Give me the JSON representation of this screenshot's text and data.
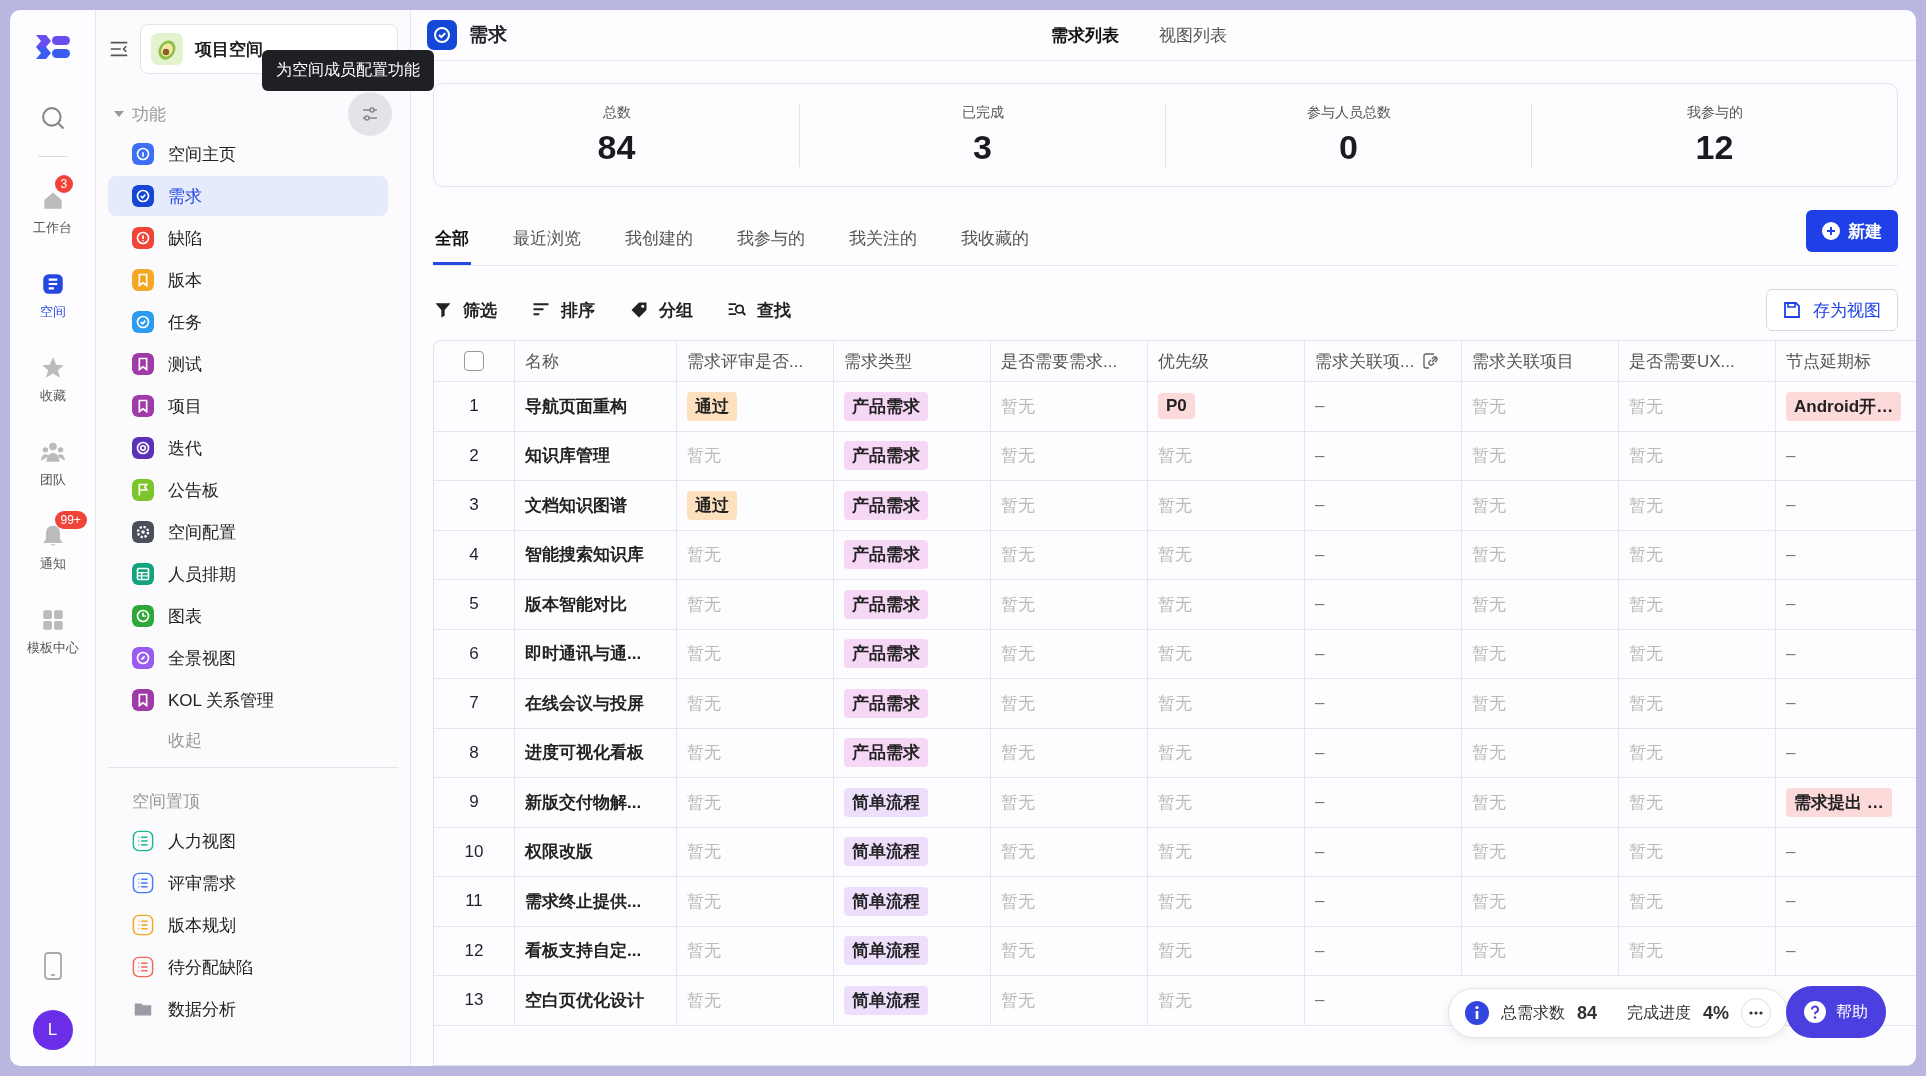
{
  "tooltip": "为空间成员配置功能",
  "rail": {
    "avatar": "L",
    "items": [
      {
        "label": "工作台",
        "badge": "3",
        "selected": false
      },
      {
        "label": "空间",
        "selected": true
      },
      {
        "label": "收藏",
        "selected": false
      },
      {
        "label": "团队",
        "selected": false
      },
      {
        "label": "通知",
        "badge": "99+",
        "selected": false
      },
      {
        "label": "模板中心",
        "selected": false
      }
    ]
  },
  "sidebar": {
    "space": "项目空间",
    "section": "功能",
    "collapse": "收起",
    "pinned_title": "空间置顶",
    "items": [
      {
        "label": "空间主页",
        "color": "#3d6ff5",
        "selected": false
      },
      {
        "label": "需求",
        "color": "#1447d6",
        "selected": true
      },
      {
        "label": "缺陷",
        "color": "#f04438",
        "selected": false
      },
      {
        "label": "版本",
        "color": "#f5a623",
        "selected": false
      },
      {
        "label": "任务",
        "color": "#2c9cf0",
        "selected": false
      },
      {
        "label": "测试",
        "color": "#a03aa8",
        "selected": false
      },
      {
        "label": "项目",
        "color": "#a03aa8",
        "selected": false
      },
      {
        "label": "迭代",
        "color": "#5a32b8",
        "selected": false
      },
      {
        "label": "公告板",
        "color": "#7cc52a",
        "selected": false
      },
      {
        "label": "空间配置",
        "color": "#4a4f5a",
        "selected": false
      },
      {
        "label": "人员排期",
        "color": "#14a37f",
        "selected": false
      },
      {
        "label": "图表",
        "color": "#2fa83a",
        "selected": false
      },
      {
        "label": "全景视图",
        "color": "#9a5cf0",
        "selected": false
      },
      {
        "label": "KOL 关系管理",
        "color": "#a03aa8",
        "selected": false
      }
    ],
    "pinned": [
      {
        "label": "人力视图",
        "kind": "view",
        "color": "#1fb59a"
      },
      {
        "label": "评审需求",
        "kind": "view",
        "color": "#4a7af5"
      },
      {
        "label": "版本规划",
        "kind": "view",
        "color": "#f5a623"
      },
      {
        "label": "待分配缺陷",
        "kind": "view",
        "color": "#f06a5a"
      },
      {
        "label": "数据分析",
        "kind": "folder",
        "color": "#9a9ca3"
      }
    ]
  },
  "header": {
    "title": "需求",
    "tabs": [
      {
        "label": "需求列表",
        "selected": true
      },
      {
        "label": "视图列表",
        "selected": false
      }
    ]
  },
  "stats": [
    {
      "label": "总数",
      "value": "84"
    },
    {
      "label": "已完成",
      "value": "3"
    },
    {
      "label": "参与人员总数",
      "value": "0"
    },
    {
      "label": "我参与的",
      "value": "12"
    }
  ],
  "filters": [
    {
      "label": "全部",
      "selected": true
    },
    {
      "label": "最近浏览",
      "selected": false
    },
    {
      "label": "我创建的",
      "selected": false
    },
    {
      "label": "我参与的",
      "selected": false
    },
    {
      "label": "我关注的",
      "selected": false
    },
    {
      "label": "我收藏的",
      "selected": false
    }
  ],
  "new_button": "新建",
  "toolbar": [
    "筛选",
    "排序",
    "分组",
    "查找"
  ],
  "save_view": "存为视图",
  "table": {
    "columns": [
      {
        "kind": "select",
        "checked": false
      },
      {
        "label": "名称",
        "kind": "plain"
      },
      {
        "label": "需求评审是否...",
        "kind": "plain"
      },
      {
        "label": "需求类型",
        "kind": "plain"
      },
      {
        "label": "是否需要需求...",
        "kind": "plain"
      },
      {
        "label": "优先级",
        "kind": "plain"
      },
      {
        "label": "需求关联项...",
        "kind": "linked"
      },
      {
        "label": "需求关联项目",
        "kind": "plain"
      },
      {
        "label": "是否需要UX...",
        "kind": "plain"
      },
      {
        "label": "节点延期标",
        "kind": "plain"
      }
    ],
    "rows": [
      {
        "cells": [
          {
            "text": "1",
            "kind": "number"
          },
          {
            "text": "导航页面重构",
            "kind": "name"
          },
          {
            "text": "通过",
            "kind": "tag",
            "color": "#fde0bd"
          },
          {
            "text": "产品需求",
            "kind": "tag",
            "color": "#f6d8f6"
          },
          {
            "text": "暂无",
            "kind": "empty"
          },
          {
            "text": "P0",
            "kind": "tag",
            "color": "#fddada"
          },
          {
            "text": "–",
            "kind": "dash"
          },
          {
            "text": "暂无",
            "kind": "empty"
          },
          {
            "text": "暂无",
            "kind": "empty"
          },
          {
            "text": "Android开…",
            "kind": "tag",
            "color": "#fddada"
          }
        ]
      },
      {
        "cells": [
          {
            "text": "2",
            "kind": "number"
          },
          {
            "text": "知识库管理",
            "kind": "name"
          },
          {
            "text": "暂无",
            "kind": "empty"
          },
          {
            "text": "产品需求",
            "kind": "tag",
            "color": "#f6d8f6"
          },
          {
            "text": "暂无",
            "kind": "empty"
          },
          {
            "text": "暂无",
            "kind": "empty"
          },
          {
            "text": "–",
            "kind": "dash"
          },
          {
            "text": "暂无",
            "kind": "empty"
          },
          {
            "text": "暂无",
            "kind": "empty"
          },
          {
            "text": "–",
            "kind": "dash"
          }
        ]
      },
      {
        "cells": [
          {
            "text": "3",
            "kind": "number"
          },
          {
            "text": "文档知识图谱",
            "kind": "name"
          },
          {
            "text": "通过",
            "kind": "tag",
            "color": "#fde0bd"
          },
          {
            "text": "产品需求",
            "kind": "tag",
            "color": "#f6d8f6"
          },
          {
            "text": "暂无",
            "kind": "empty"
          },
          {
            "text": "暂无",
            "kind": "empty"
          },
          {
            "text": "–",
            "kind": "dash"
          },
          {
            "text": "暂无",
            "kind": "empty"
          },
          {
            "text": "暂无",
            "kind": "empty"
          },
          {
            "text": "–",
            "kind": "dash"
          }
        ]
      },
      {
        "cells": [
          {
            "text": "4",
            "kind": "number"
          },
          {
            "text": "智能搜索知识库",
            "kind": "name"
          },
          {
            "text": "暂无",
            "kind": "empty"
          },
          {
            "text": "产品需求",
            "kind": "tag",
            "color": "#f6d8f6"
          },
          {
            "text": "暂无",
            "kind": "empty"
          },
          {
            "text": "暂无",
            "kind": "empty"
          },
          {
            "text": "–",
            "kind": "dash"
          },
          {
            "text": "暂无",
            "kind": "empty"
          },
          {
            "text": "暂无",
            "kind": "empty"
          },
          {
            "text": "–",
            "kind": "dash"
          }
        ]
      },
      {
        "cells": [
          {
            "text": "5",
            "kind": "number"
          },
          {
            "text": "版本智能对比",
            "kind": "name"
          },
          {
            "text": "暂无",
            "kind": "empty"
          },
          {
            "text": "产品需求",
            "kind": "tag",
            "color": "#f6d8f6"
          },
          {
            "text": "暂无",
            "kind": "empty"
          },
          {
            "text": "暂无",
            "kind": "empty"
          },
          {
            "text": "–",
            "kind": "dash"
          },
          {
            "text": "暂无",
            "kind": "empty"
          },
          {
            "text": "暂无",
            "kind": "empty"
          },
          {
            "text": "–",
            "kind": "dash"
          }
        ]
      },
      {
        "cells": [
          {
            "text": "6",
            "kind": "number"
          },
          {
            "text": "即时通讯与通...",
            "kind": "name"
          },
          {
            "text": "暂无",
            "kind": "empty"
          },
          {
            "text": "产品需求",
            "kind": "tag",
            "color": "#f6d8f6"
          },
          {
            "text": "暂无",
            "kind": "empty"
          },
          {
            "text": "暂无",
            "kind": "empty"
          },
          {
            "text": "–",
            "kind": "dash"
          },
          {
            "text": "暂无",
            "kind": "empty"
          },
          {
            "text": "暂无",
            "kind": "empty"
          },
          {
            "text": "–",
            "kind": "dash"
          }
        ]
      },
      {
        "cells": [
          {
            "text": "7",
            "kind": "number"
          },
          {
            "text": "在线会议与投屏",
            "kind": "name"
          },
          {
            "text": "暂无",
            "kind": "empty"
          },
          {
            "text": "产品需求",
            "kind": "tag",
            "color": "#f6d8f6"
          },
          {
            "text": "暂无",
            "kind": "empty"
          },
          {
            "text": "暂无",
            "kind": "empty"
          },
          {
            "text": "–",
            "kind": "dash"
          },
          {
            "text": "暂无",
            "kind": "empty"
          },
          {
            "text": "暂无",
            "kind": "empty"
          },
          {
            "text": "–",
            "kind": "dash"
          }
        ]
      },
      {
        "cells": [
          {
            "text": "8",
            "kind": "number"
          },
          {
            "text": "进度可视化看板",
            "kind": "name"
          },
          {
            "text": "暂无",
            "kind": "empty"
          },
          {
            "text": "产品需求",
            "kind": "tag",
            "color": "#f6d8f6"
          },
          {
            "text": "暂无",
            "kind": "empty"
          },
          {
            "text": "暂无",
            "kind": "empty"
          },
          {
            "text": "–",
            "kind": "dash"
          },
          {
            "text": "暂无",
            "kind": "empty"
          },
          {
            "text": "暂无",
            "kind": "empty"
          },
          {
            "text": "–",
            "kind": "dash"
          }
        ]
      },
      {
        "cells": [
          {
            "text": "9",
            "kind": "number"
          },
          {
            "text": "新版交付物解...",
            "kind": "name"
          },
          {
            "text": "暂无",
            "kind": "empty"
          },
          {
            "text": "简单流程",
            "kind": "tag",
            "color": "#eddffb"
          },
          {
            "text": "暂无",
            "kind": "empty"
          },
          {
            "text": "暂无",
            "kind": "empty"
          },
          {
            "text": "–",
            "kind": "dash"
          },
          {
            "text": "暂无",
            "kind": "empty"
          },
          {
            "text": "暂无",
            "kind": "empty"
          },
          {
            "text": "需求提出 …",
            "kind": "tag",
            "color": "#fddada"
          }
        ]
      },
      {
        "cells": [
          {
            "text": "10",
            "kind": "number"
          },
          {
            "text": "权限改版",
            "kind": "name"
          },
          {
            "text": "暂无",
            "kind": "empty"
          },
          {
            "text": "简单流程",
            "kind": "tag",
            "color": "#eddffb"
          },
          {
            "text": "暂无",
            "kind": "empty"
          },
          {
            "text": "暂无",
            "kind": "empty"
          },
          {
            "text": "–",
            "kind": "dash"
          },
          {
            "text": "暂无",
            "kind": "empty"
          },
          {
            "text": "暂无",
            "kind": "empty"
          },
          {
            "text": "–",
            "kind": "dash"
          }
        ]
      },
      {
        "cells": [
          {
            "text": "11",
            "kind": "number"
          },
          {
            "text": "需求终止提供...",
            "kind": "name"
          },
          {
            "text": "暂无",
            "kind": "empty"
          },
          {
            "text": "简单流程",
            "kind": "tag",
            "color": "#eddffb"
          },
          {
            "text": "暂无",
            "kind": "empty"
          },
          {
            "text": "暂无",
            "kind": "empty"
          },
          {
            "text": "–",
            "kind": "dash"
          },
          {
            "text": "暂无",
            "kind": "empty"
          },
          {
            "text": "暂无",
            "kind": "empty"
          },
          {
            "text": "–",
            "kind": "dash"
          }
        ]
      },
      {
        "cells": [
          {
            "text": "12",
            "kind": "number"
          },
          {
            "text": "看板支持自定...",
            "kind": "name"
          },
          {
            "text": "暂无",
            "kind": "empty"
          },
          {
            "text": "简单流程",
            "kind": "tag",
            "color": "#eddffb"
          },
          {
            "text": "暂无",
            "kind": "empty"
          },
          {
            "text": "暂无",
            "kind": "empty"
          },
          {
            "text": "–",
            "kind": "dash"
          },
          {
            "text": "暂无",
            "kind": "empty"
          },
          {
            "text": "暂无",
            "kind": "empty"
          },
          {
            "text": "–",
            "kind": "dash"
          }
        ]
      },
      {
        "cells": [
          {
            "text": "13",
            "kind": "number"
          },
          {
            "text": "空白页优化设计",
            "kind": "name"
          },
          {
            "text": "暂无",
            "kind": "empty"
          },
          {
            "text": "简单流程",
            "kind": "tag",
            "color": "#eddffb"
          },
          {
            "text": "暂无",
            "kind": "empty"
          },
          {
            "text": "暂无",
            "kind": "empty"
          },
          {
            "text": "–",
            "kind": "dash"
          }
        ]
      }
    ]
  },
  "summary": {
    "total_label": "总需求数",
    "total": "84",
    "progress_label": "完成进度",
    "progress": "4%"
  },
  "help": "帮助"
}
